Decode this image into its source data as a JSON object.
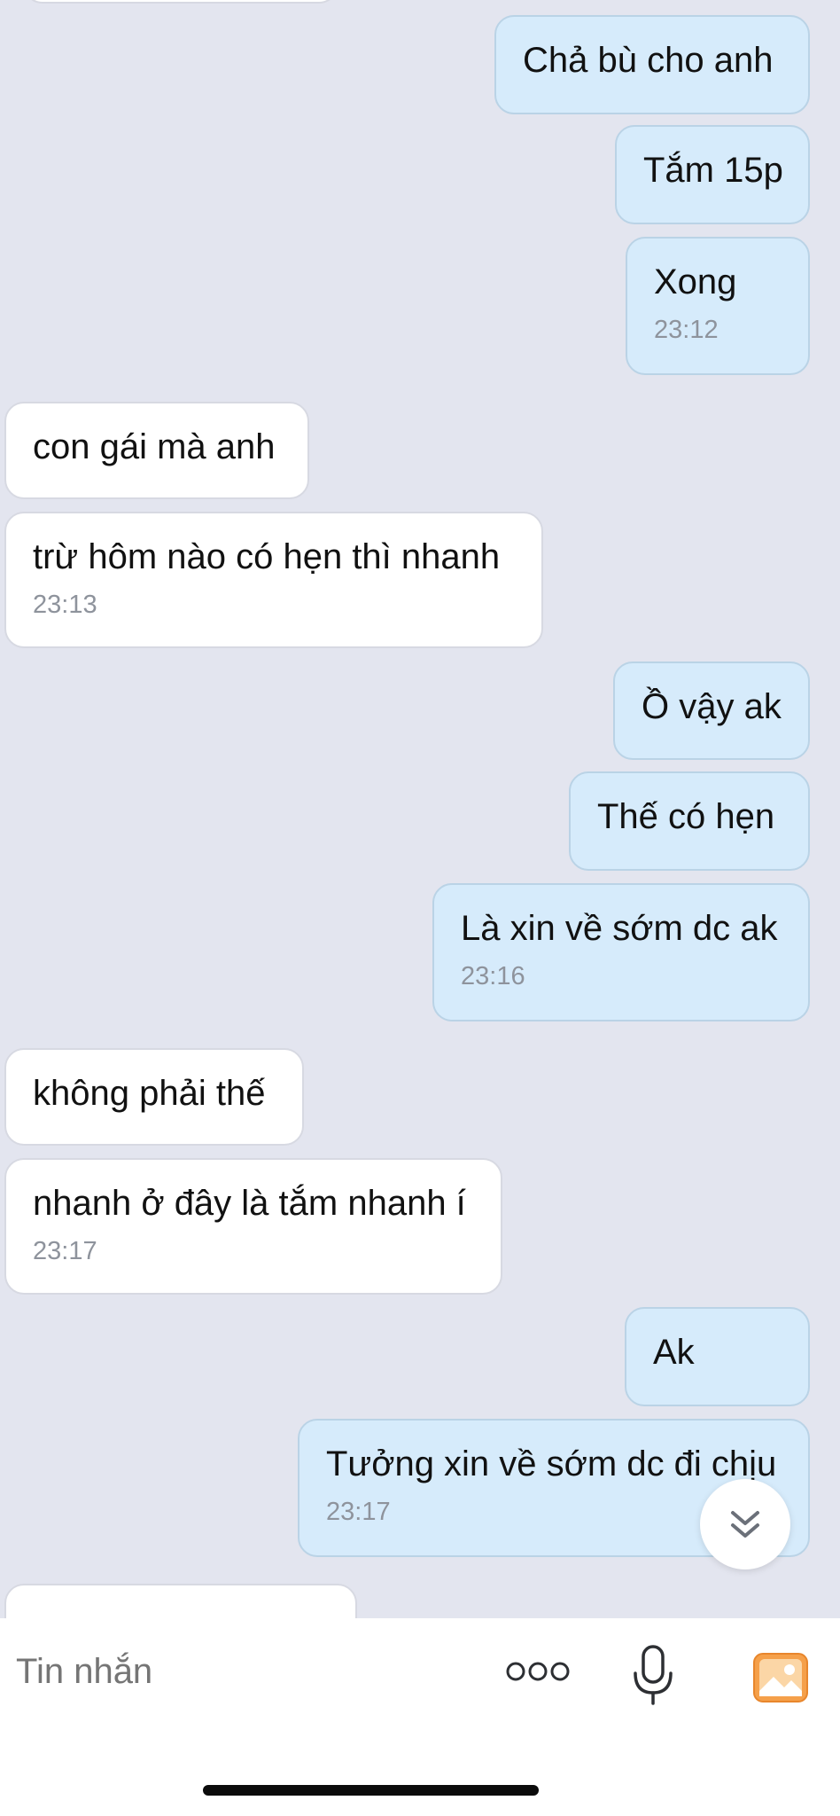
{
  "conversation": {
    "messages": [
      {
        "direction": "sent",
        "text": "Chả bù cho anh",
        "time": ""
      },
      {
        "direction": "sent",
        "text": "Tắm 15p",
        "time": ""
      },
      {
        "direction": "sent",
        "text": "Xong",
        "time": "23:12"
      },
      {
        "direction": "received",
        "text": "con gái mà anh",
        "time": ""
      },
      {
        "direction": "received",
        "text": "trừ hôm nào có hẹn thì nhanh",
        "time": "23:13"
      },
      {
        "direction": "sent",
        "text": "Ồ vậy ak",
        "time": ""
      },
      {
        "direction": "sent",
        "text": "Thế có hẹn",
        "time": ""
      },
      {
        "direction": "sent",
        "text": "Là xin về sớm dc ak",
        "time": "23:16"
      },
      {
        "direction": "received",
        "text": "không phải thế",
        "time": ""
      },
      {
        "direction": "received",
        "text": "nhanh ở đây là tắm nhanh í",
        "time": "23:17"
      },
      {
        "direction": "sent",
        "text": "Ak",
        "time": ""
      },
      {
        "direction": "sent",
        "text": "Tưởng xin về sớm dc đi chịu",
        "time": "23:17"
      }
    ]
  },
  "scroll_button": {
    "icon": "double-chevron-down-icon"
  },
  "composer": {
    "placeholder": "Tin nhắn",
    "icons": [
      "more-options-icon",
      "microphone-icon",
      "gallery-icon"
    ],
    "gallery_color": "#f5a04a"
  },
  "colors": {
    "background": "#e3e5ef",
    "sent_bubble": "#d6ebfb",
    "received_bubble": "#ffffff"
  }
}
